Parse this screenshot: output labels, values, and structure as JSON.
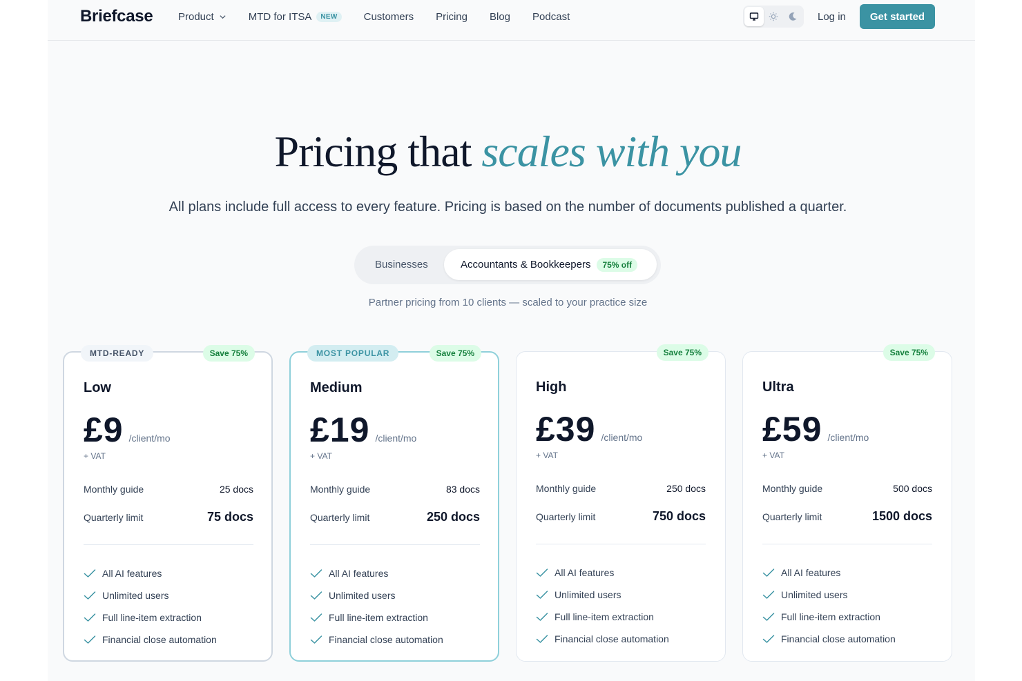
{
  "header": {
    "logo": "Briefcase",
    "nav": [
      {
        "label": "Product",
        "has_dropdown": true
      },
      {
        "label": "MTD for ITSA",
        "badge": "NEW"
      },
      {
        "label": "Customers"
      },
      {
        "label": "Pricing"
      },
      {
        "label": "Blog"
      },
      {
        "label": "Podcast"
      }
    ],
    "theme_options": [
      "monitor-icon",
      "sun-icon",
      "moon-icon"
    ],
    "theme_selected": "monitor-icon",
    "login": "Log in",
    "cta": "Get started"
  },
  "hero": {
    "title_plain": "Pricing that",
    "title_accent": "scales with you",
    "subtitle": "All plans include full access to every feature. Pricing is based on the number of documents published a quarter."
  },
  "toggle": {
    "options": [
      "Businesses",
      "Accountants & Bookkeepers"
    ],
    "selected": "Accountants & Bookkeepers",
    "badge": "75% off",
    "note": "Partner pricing from 10 clients — scaled to your practice size"
  },
  "plans": [
    {
      "tag": "MTD-READY",
      "save": "Save 75%",
      "name": "Low",
      "price": "£9",
      "period": "/client/mo",
      "vat": "+ VAT",
      "monthly_label": "Monthly guide",
      "monthly_value": "25 docs",
      "quarterly_label": "Quarterly limit",
      "quarterly_value": "75 docs",
      "features": [
        "All AI features",
        "Unlimited users",
        "Full line-item extraction",
        "Financial close automation"
      ]
    },
    {
      "tag": "MOST POPULAR",
      "save": "Save 75%",
      "name": "Medium",
      "price": "£19",
      "period": "/client/mo",
      "vat": "+ VAT",
      "monthly_label": "Monthly guide",
      "monthly_value": "83 docs",
      "quarterly_label": "Quarterly limit",
      "quarterly_value": "250 docs",
      "features": [
        "All AI features",
        "Unlimited users",
        "Full line-item extraction",
        "Financial close automation"
      ]
    },
    {
      "tag": "",
      "save": "Save 75%",
      "name": "High",
      "price": "£39",
      "period": "/client/mo",
      "vat": "+ VAT",
      "monthly_label": "Monthly guide",
      "monthly_value": "250 docs",
      "quarterly_label": "Quarterly limit",
      "quarterly_value": "750 docs",
      "features": [
        "All AI features",
        "Unlimited users",
        "Full line-item extraction",
        "Financial close automation"
      ]
    },
    {
      "tag": "",
      "save": "Save 75%",
      "name": "Ultra",
      "price": "£59",
      "period": "/client/mo",
      "vat": "+ VAT",
      "monthly_label": "Monthly guide",
      "monthly_value": "500 docs",
      "quarterly_label": "Quarterly limit",
      "quarterly_value": "1500 docs",
      "features": [
        "All AI features",
        "Unlimited users",
        "Full line-item extraction",
        "Financial close automation"
      ]
    }
  ],
  "colors": {
    "accent": "#3b93a3",
    "save_badge_bg": "#dcfce7",
    "save_badge_text": "#15803d",
    "check": "#3b93a3"
  }
}
